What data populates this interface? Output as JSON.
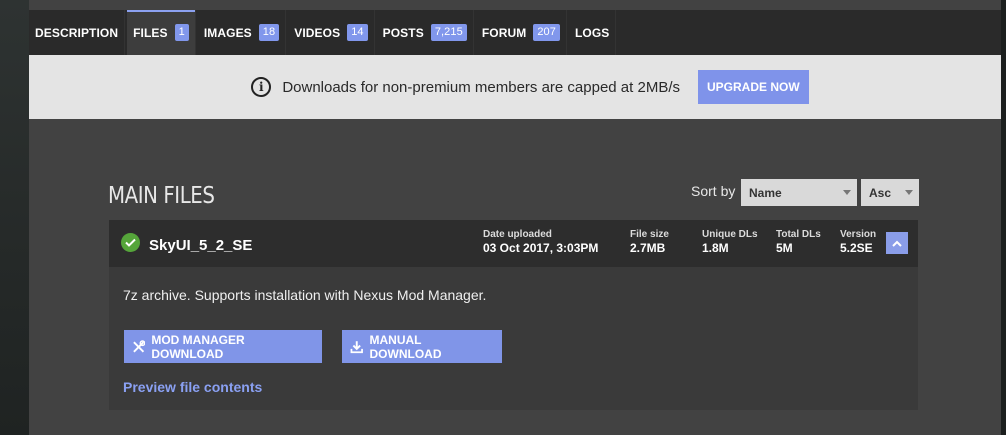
{
  "tabs": [
    {
      "label": "DESCRIPTION",
      "count": null
    },
    {
      "label": "FILES",
      "count": "1"
    },
    {
      "label": "IMAGES",
      "count": "18"
    },
    {
      "label": "VIDEOS",
      "count": "14"
    },
    {
      "label": "POSTS",
      "count": "7,215"
    },
    {
      "label": "FORUM",
      "count": "207"
    },
    {
      "label": "LOGS",
      "count": null
    }
  ],
  "active_tab": "FILES",
  "banner": {
    "icon": "info-icon",
    "text": "Downloads for non-premium members are capped at 2MB/s",
    "button": "UPGRADE NOW"
  },
  "files_section": {
    "heading": "MAIN FILES",
    "sort_label": "Sort by",
    "sort_field": "Name",
    "sort_order": "Asc"
  },
  "file": {
    "name": "SkyUI_5_2_SE",
    "status_icon": "check-circle-icon",
    "stats": [
      {
        "label": "Date uploaded",
        "value": "03 Oct 2017, 3:03PM"
      },
      {
        "label": "File size",
        "value": "2.7MB"
      },
      {
        "label": "Unique DLs",
        "value": "1.8M"
      },
      {
        "label": "Total DLs",
        "value": "5M"
      },
      {
        "label": "Version",
        "value": "5.2SE"
      }
    ],
    "description": "7z archive. Supports installation with Nexus Mod Manager.",
    "mod_manager_button": "MOD MANAGER DOWNLOAD",
    "manual_button": "MANUAL DOWNLOAD",
    "preview_link": "Preview file contents"
  },
  "colors": {
    "accent": "#8095e8",
    "link": "#8aa0f2",
    "success": "#55a53a"
  }
}
